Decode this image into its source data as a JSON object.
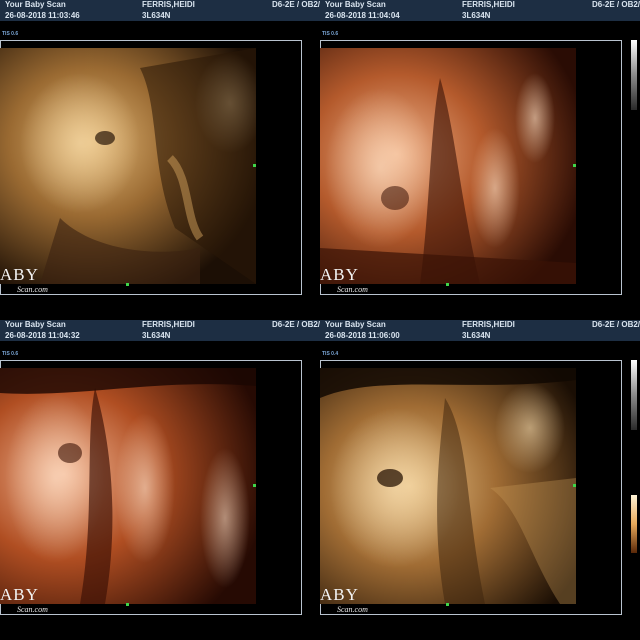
{
  "colors": {
    "header_bg": "#1d2e43",
    "header_text": "#d9e4ef",
    "tis_text": "#7aa6d6",
    "frame_border": "#b9c3cf",
    "marker_green": "#3fd64a"
  },
  "panels": [
    {
      "clinic": "Your Baby Scan",
      "datetime": "26-08-2018 11:03:46",
      "patient": "FERRIS,HEIDI",
      "patient_id": "3L634N",
      "probe": "D6-2E / OB2/",
      "tis": "TIS 0.6",
      "watermark_main": "ABY",
      "watermark_sub": "Scan.com",
      "tone": "sepia"
    },
    {
      "clinic": "Your Baby Scan",
      "datetime": "26-08-2018 11:04:04",
      "patient": "FERRIS,HEIDI",
      "patient_id": "3L634N",
      "probe": "D6-2E / OB2/",
      "tis": "TIS 0.6",
      "watermark_main": "ABY",
      "watermark_sub": "Scan.com",
      "tone": "copper"
    },
    {
      "clinic": "Your Baby Scan",
      "datetime": "26-08-2018 11:04:32",
      "patient": "FERRIS,HEIDI",
      "patient_id": "3L634N",
      "probe": "D6-2E / OB2/",
      "tis": "TIS 0.6",
      "watermark_main": "ABY",
      "watermark_sub": "Scan.com",
      "tone": "copper"
    },
    {
      "clinic": "Your Baby Scan",
      "datetime": "26-08-2018 11:06:00",
      "patient": "FERRIS,HEIDI",
      "patient_id": "3L634N",
      "probe": "D6-2E / OB2/",
      "tis": "TIS 0.4",
      "watermark_main": "ABY",
      "watermark_sub": "Scan.com",
      "tone": "sepia"
    }
  ]
}
